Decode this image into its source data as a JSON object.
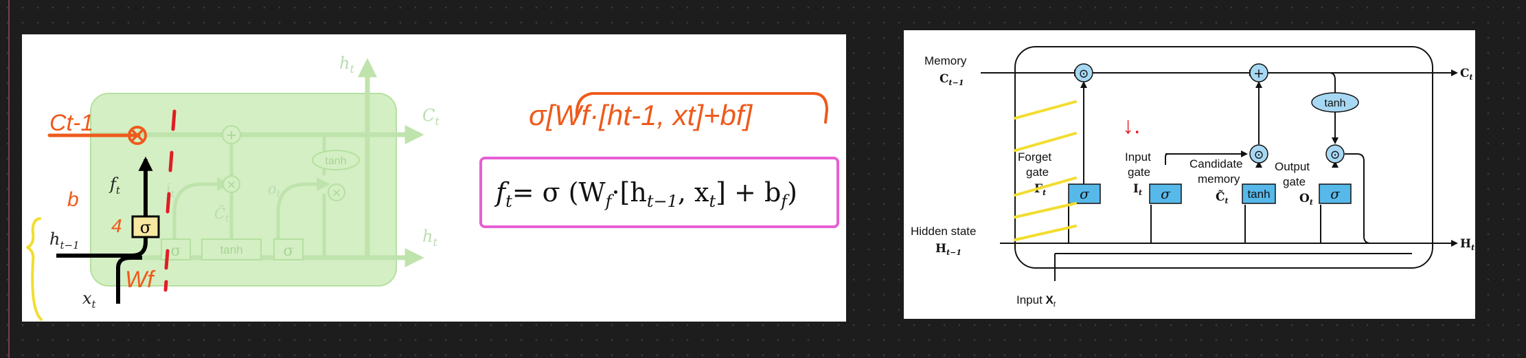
{
  "forget_gate_panel": {
    "faded_cell": {
      "labels": {
        "cell_state_out": "C",
        "cell_state_out_sub": "t",
        "hidden_top": "h",
        "hidden_top_sub": "t",
        "hidden_right": "h",
        "hidden_right_sub": "t",
        "input_gate_out": "i",
        "input_gate_out_sub": "t",
        "candidate": "C̃",
        "candidate_sub": "t",
        "output_gate_out": "o",
        "output_gate_out_sub": "t",
        "plus": "+",
        "times1": "×",
        "times2": "×",
        "tanh_box": "tanh",
        "tanh_oval": "tanh",
        "sigma2": "σ",
        "sigma3": "σ"
      }
    },
    "highlighted": {
      "forget_label": "f",
      "forget_label_sub": "t",
      "sigma": "σ",
      "h_prev": "h",
      "h_prev_sub": "t−1",
      "x_in": "x",
      "x_in_sub": "t"
    },
    "handwritten": {
      "c_prev": "Ct-1",
      "b": "b",
      "four": "4",
      "wf": "Wf",
      "formula": "σ[Wf·[ht-1, xt]+bf]"
    },
    "equation": {
      "lhs": "f",
      "lhs_sub": "t",
      "eq": "= σ (W",
      "w_sub": "f",
      "mid": "·[h",
      "h_sub": "t−1",
      "comma": ", x",
      "x_sub": "t",
      "plus": "]  +  b",
      "b_sub": "f",
      "close": ")"
    }
  },
  "lstm_panel": {
    "labels": {
      "memory": "Memory",
      "memory_var": "C",
      "memory_sub": "t−1",
      "hidden_state": "Hidden state",
      "hidden_var": "H",
      "hidden_sub": "t−1",
      "input": "Input ",
      "input_var": "X",
      "input_sub": "t",
      "forget_gate_1": "Forget",
      "forget_gate_2": "gate",
      "forget_var": "F",
      "forget_sub": "t",
      "input_gate_1": "Input",
      "input_gate_2": "gate",
      "input_gate_var": "I",
      "input_gate_sub": "t",
      "candidate_1": "Candidate",
      "candidate_2": "memory",
      "candidate_var": "C̃",
      "candidate_sub": "t",
      "output_gate_1": "Output",
      "output_gate_2": "gate",
      "output_var": "O",
      "output_sub": "t",
      "c_out": "C",
      "c_out_sub": "t",
      "h_out": "H",
      "h_out_sub": "t"
    },
    "blocks": {
      "sigma_forget": "σ",
      "sigma_input": "σ",
      "tanh_candidate": "tanh",
      "sigma_output": "σ",
      "tanh_oval": "tanh",
      "op_mult1": "⊙",
      "op_plus": "+",
      "op_mult2": "⊙",
      "op_mult3": "⊙"
    },
    "annotation": "↓."
  },
  "colors": {
    "background": "#1d1d1d",
    "faded_cell_fill": "#d4efc4",
    "faded_cell_stroke": "#a7d991",
    "sigma_box_fill": "#f6e7a1",
    "handwriting_orange": "#ee5a1c",
    "handwriting_red": "#e01e25",
    "handwriting_yellow": "#f2dd2e",
    "equation_box": "#e65fd3",
    "lstm_block_fill": "#57b8ea",
    "lstm_oval_fill": "#a7d8f3"
  }
}
